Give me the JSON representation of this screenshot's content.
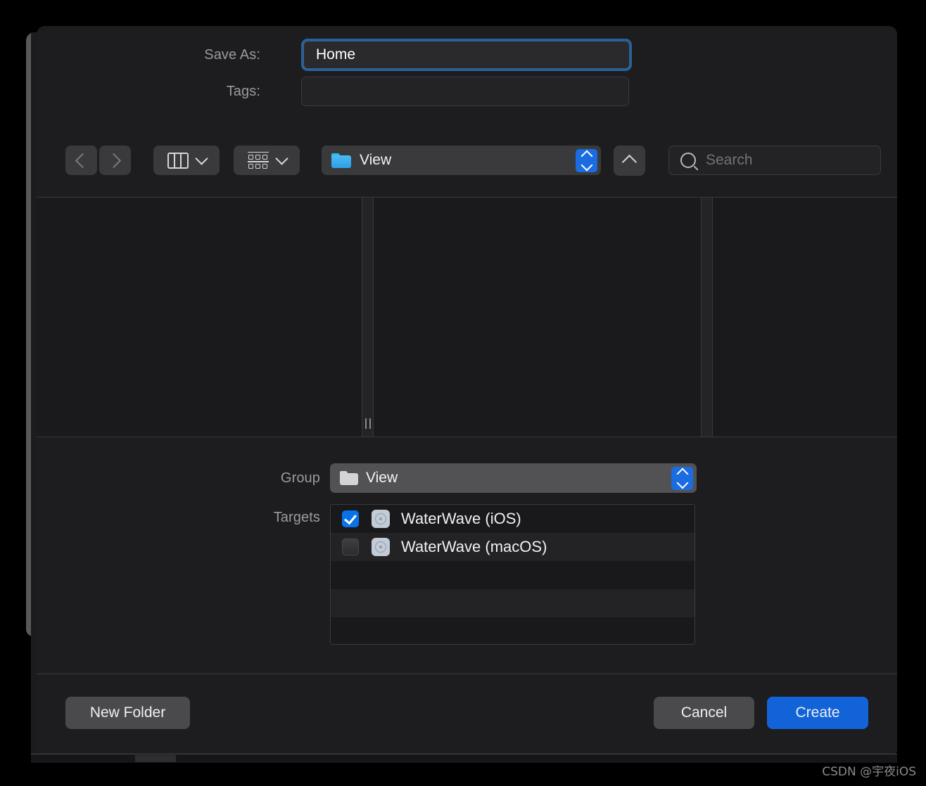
{
  "dialog": {
    "save_as_label": "Save As:",
    "save_as_value": "Home",
    "tags_label": "Tags:",
    "tags_value": "",
    "tags_placeholder": ""
  },
  "toolbar": {
    "back_icon": "chevron-left-icon",
    "forward_icon": "chevron-right-icon",
    "view_mode_icon": "column-view-icon",
    "group_mode_icon": "group-by-icon",
    "path_label": "View",
    "path_folder_icon": "folder-icon",
    "stepper_icon": "stepper-arrows-icon",
    "up_icon": "chevron-up-icon",
    "search_icon": "search-icon",
    "search_value": "",
    "search_placeholder": "Search"
  },
  "browser": {
    "columns": [
      "",
      "",
      ""
    ],
    "grip_icon": "resize-grip-icon"
  },
  "options": {
    "group_label": "Group",
    "group_value": "View",
    "group_folder_icon": "folder-icon",
    "group_stepper_icon": "stepper-arrows-icon",
    "targets_label": "Targets",
    "targets": [
      {
        "name": "WaterWave (iOS)",
        "checked": true,
        "icon": "target-icon"
      },
      {
        "name": "WaterWave (macOS)",
        "checked": false,
        "icon": "target-icon"
      }
    ]
  },
  "footer": {
    "new_folder_label": "New Folder",
    "cancel_label": "Cancel",
    "create_label": "Create"
  },
  "watermark": {
    "text": "CSDN @宇夜iOS"
  },
  "colors": {
    "accent_blue": "#1263d8",
    "focus_ring": "#2d6099",
    "stepper_blue": "#1a6ce0",
    "checkbox_blue": "#0a72e8",
    "folder_blue": "#3db2ef",
    "dialog_bg": "#1d1d1f"
  }
}
